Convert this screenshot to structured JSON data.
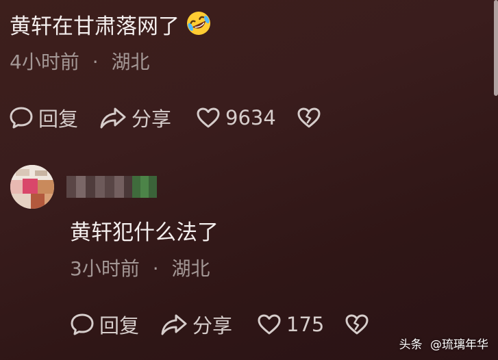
{
  "comment1": {
    "text": "黄轩在甘肃落网了",
    "emoji_icon": "rolling-on-floor-laughing-icon",
    "time": "4小时前",
    "separator": "·",
    "location": "湖北",
    "reply_label": "回复",
    "share_label": "分享",
    "like_count": "9634"
  },
  "comment2": {
    "text": "黄轩犯什么法了",
    "time": "3小时前",
    "separator": "·",
    "location": "湖北",
    "reply_label": "回复",
    "share_label": "分享",
    "like_count": "175"
  },
  "watermark": {
    "app": "头条",
    "handle": "@琉璃年华"
  },
  "colors": {
    "background": "#3a1d1d",
    "text_primary": "#f4efee",
    "text_secondary": "#a49896",
    "icon": "#d6cdcb"
  }
}
